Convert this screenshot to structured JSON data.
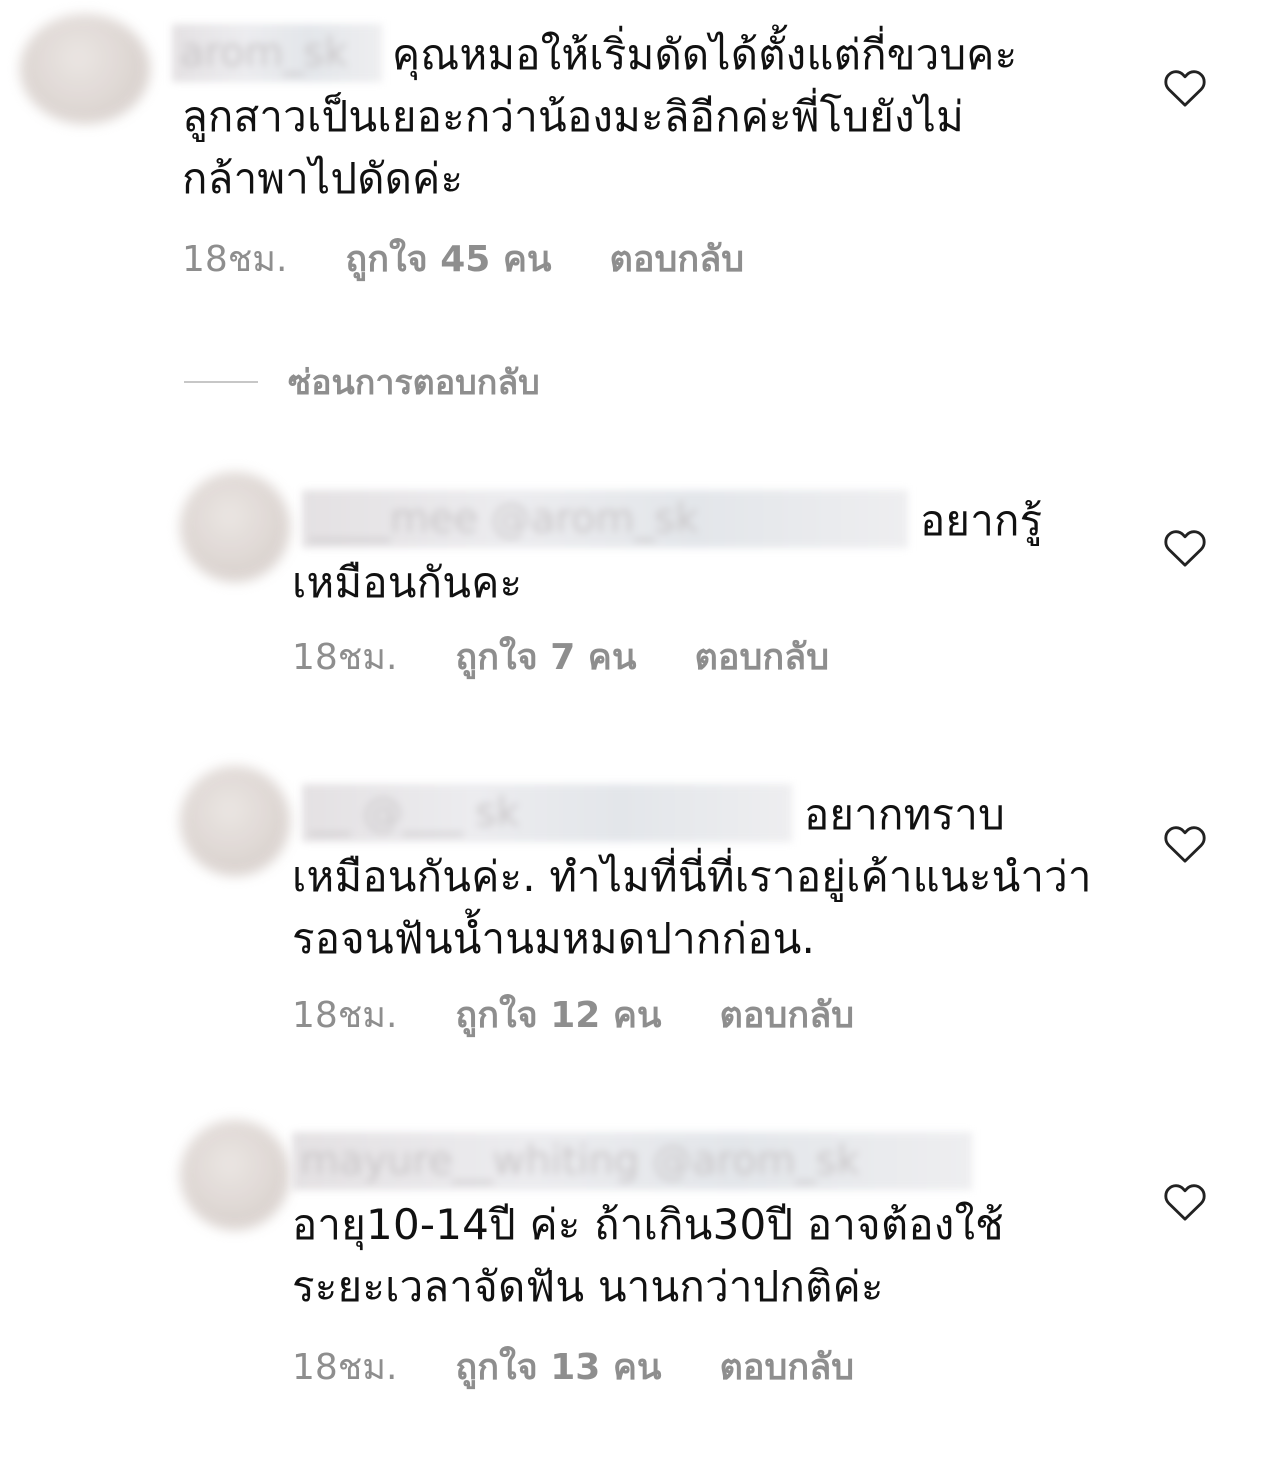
{
  "comments": [
    {
      "username": "arom_sk",
      "text_line1": "คุณหมอให้เริ่มดัดได้ตั้งแต่กี่ขวบคะ",
      "text_rest": "ลูกสาวเป็นเยอะกว่าน้องมะลิอีกค่ะพี่โบยังไม่กล้าพาไปดัดค่ะ",
      "time": "18ชม.",
      "likes": "ถูกใจ 45 คน",
      "reply": "ตอบกลับ"
    },
    {
      "username": "____mee @arom_sk",
      "text_line1": "อยากรู้",
      "text_rest": "เหมือนกันคะ",
      "time": "18ชม.",
      "likes": "ถูกใจ 7 คน",
      "reply": "ตอบกลับ"
    },
    {
      "username": "__ @___ sk",
      "text_line1": "อยากทราบ",
      "text_rest": "เหมือนกันค่ะ. ทำไมที่นี่ที่เราอยู่เค้าแนะนำว่ารอจนฟันน้ำนมหมดปากก่อน.",
      "time": "18ชม.",
      "likes": "ถูกใจ 12 คน",
      "reply": "ตอบกลับ"
    },
    {
      "username": "mayure__whiting @arom_sk",
      "text_line1": "",
      "text_rest": "อายุ10-14ปี ค่ะ ถ้าเกิน30ปี อาจต้องใช้ระยะเวลาจัดฟัน นานกว่าปกติค่ะ",
      "time": "18ชม.",
      "likes": "ถูกใจ 13 คน",
      "reply": "ตอบกลับ"
    }
  ],
  "hide_replies_label": "ซ่อนการตอบกลับ",
  "icons": {
    "like": "heart-outline-icon"
  },
  "colors": {
    "text": "#111111",
    "muted": "#8e8e8e",
    "divider": "#c7c7c7"
  }
}
